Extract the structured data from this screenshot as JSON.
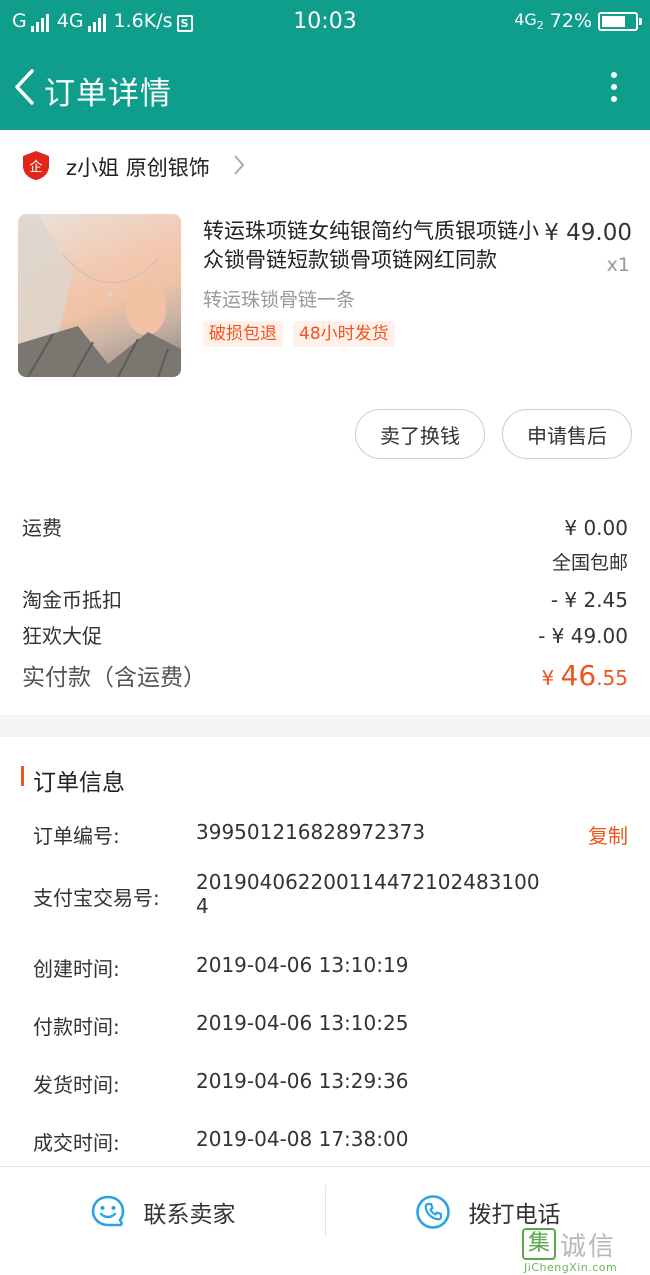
{
  "status_bar": {
    "carrier_left": "G",
    "network": "4G",
    "speed": "1.6K/s",
    "s_icon_text": "S",
    "time": "10:03",
    "network_right": "4G",
    "network_right_sub": "2",
    "battery": "72%",
    "battery_level": 0.72
  },
  "title_bar": {
    "title": "订单详情",
    "back_icon": "chevron-left-icon",
    "more_icon": "more-vertical-icon"
  },
  "shop": {
    "badge_text": "企",
    "name": "z小姐 原创银饰"
  },
  "product": {
    "title": "转运珠项链女纯银简约气质银项链小众锁骨链短款锁骨项链网红同款",
    "price": "¥ 49.00",
    "quantity": "x1",
    "sku": "转运珠锁骨链一条",
    "tags": [
      "破损包退",
      "48小时发货"
    ]
  },
  "actions": {
    "sell_label": "卖了换钱",
    "aftersale_label": "申请售后"
  },
  "costs": {
    "shipping_label": "运费",
    "shipping_value": "¥ 0.00",
    "shipping_note": "全国包邮",
    "coin_label": "淘金币抵扣",
    "coin_value": "- ¥ 2.45",
    "promo_label": "狂欢大促",
    "promo_value": "- ¥ 49.00",
    "paid_label": "实付款（含运费）",
    "paid_currency": "¥ ",
    "paid_int": "46",
    "paid_dec": ".55"
  },
  "order_info": {
    "title": "订单信息",
    "copy_label": "复制",
    "rows": [
      {
        "label": "订单编号:",
        "value": "399501216828972373"
      },
      {
        "label": "支付宝交易号:",
        "value": "2019040622001144721024831004"
      },
      {
        "label": "创建时间:",
        "value": "2019-04-06 13:10:19"
      },
      {
        "label": "付款时间:",
        "value": "2019-04-06 13:10:25"
      },
      {
        "label": "发货时间:",
        "value": "2019-04-06 13:29:36"
      },
      {
        "label": "成交时间:",
        "value": "2019-04-08 17:38:00"
      }
    ]
  },
  "bottom_bar": {
    "contact_label": "联系卖家",
    "contact_icon": "chat-bubble-icon",
    "call_label": "拨打电话",
    "call_icon": "phone-icon"
  },
  "watermark": {
    "box_char": "集",
    "text": "诚信",
    "url": "JiChengXin.com"
  },
  "colors": {
    "header": "#0f9d8c",
    "accent": "#f0541e",
    "icon_blue": "#2aa3e6"
  }
}
